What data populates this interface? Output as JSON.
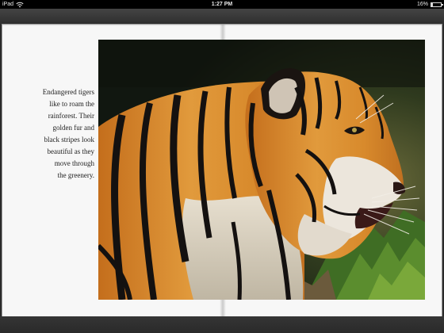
{
  "status_bar": {
    "device": "iPad",
    "time": "1:27 PM",
    "battery_text": "16%",
    "battery_level": 0.16
  },
  "book": {
    "caption": "Endangered tigers\nlike to roam the\nrainforest. Their\ngolden fur and\nblack stripes look\nbeautiful as they\nmove through\nthe greenery."
  },
  "colors": {
    "status_bar_bg": "#000000",
    "page_bg": "#f7f7f7",
    "tiger_orange": "#d9872a",
    "stripe": "#141110"
  },
  "icons": {
    "wifi": "wifi-icon",
    "battery": "battery-icon"
  }
}
